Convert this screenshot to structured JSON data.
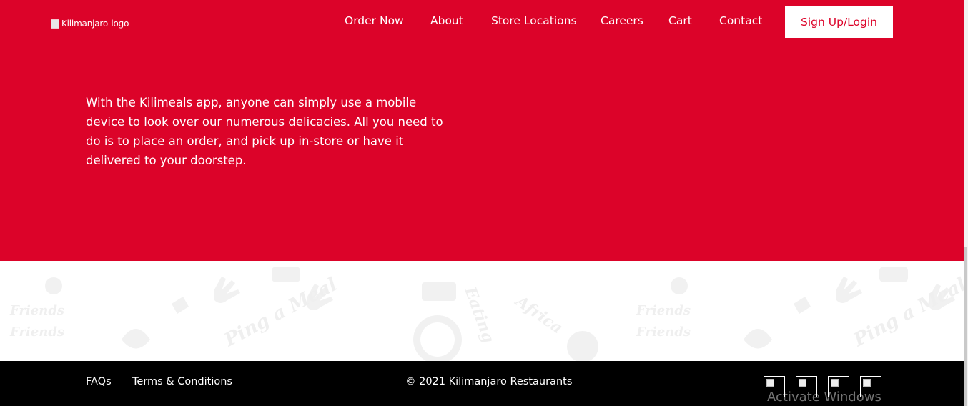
{
  "header": {
    "logo_alt": "Kilimanjaro-logo",
    "nav": [
      {
        "label": "Order Now"
      },
      {
        "label": "About"
      },
      {
        "label": "Store Locations"
      },
      {
        "label": "Careers"
      },
      {
        "label": "Cart"
      },
      {
        "label": "Contact"
      }
    ],
    "signup_label": "Sign Up/Login"
  },
  "hero": {
    "text": "With the Kilimeals app, anyone can simply use a mobile device to look over our numerous delicacies. All you need to do is to place an order, and pick up in-store or have it delivered to your doorstep."
  },
  "pattern": {
    "words": [
      "Friends serving Friends",
      "Ping a Meal",
      "Taste of Africa",
      "Eating"
    ]
  },
  "footer": {
    "links": [
      {
        "label": "FAQs"
      },
      {
        "label": "Terms & Conditions"
      }
    ],
    "copyright": "© 2021 Kilimanjaro Restaurants",
    "social_icons": [
      "social-icon",
      "social-icon",
      "social-icon",
      "social-icon"
    ]
  },
  "os_watermark": "Activate Windows",
  "colors": {
    "brand_red": "#dc0329",
    "footer_bg": "#000000",
    "text_light": "#ffffff"
  }
}
